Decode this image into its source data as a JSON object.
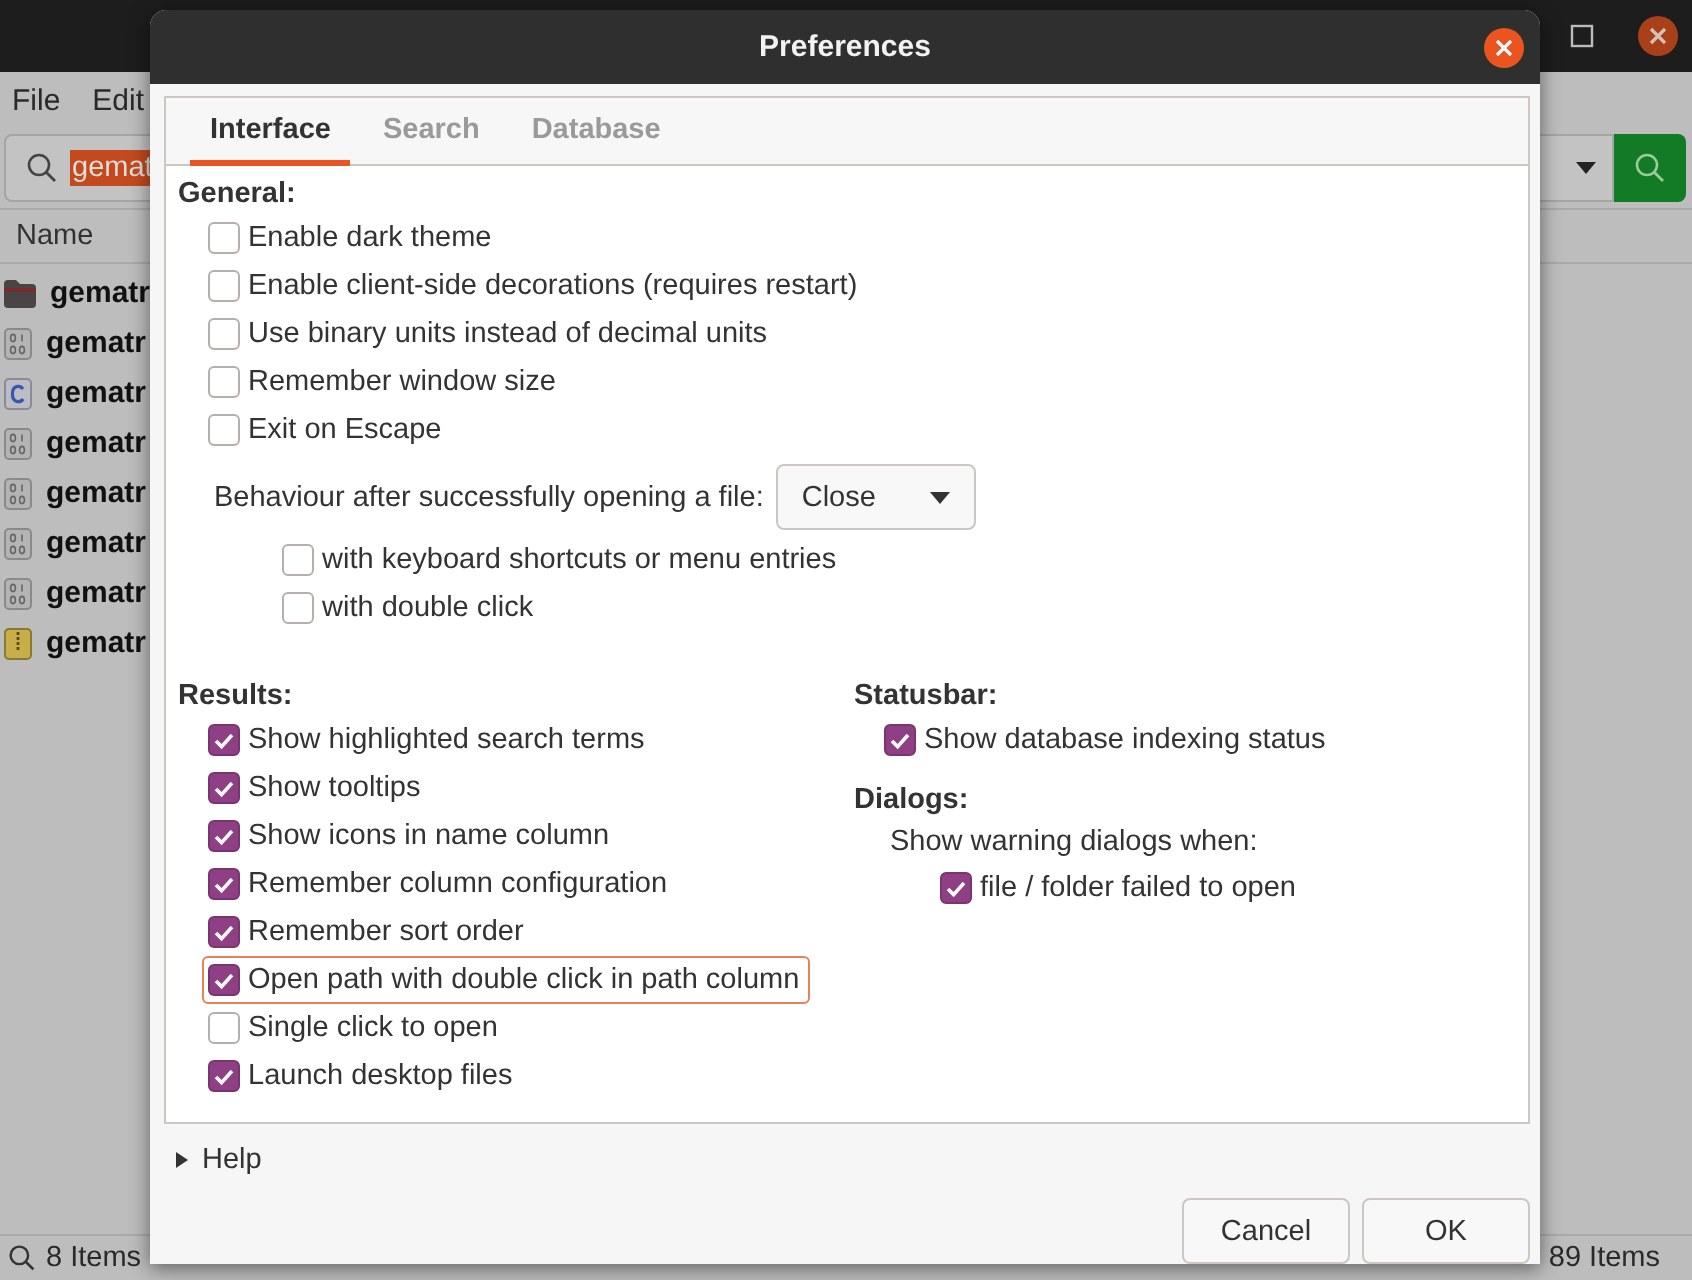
{
  "app": {
    "menu": [
      "File",
      "Edit"
    ],
    "search": {
      "value": "gemat"
    },
    "column_header": "Name",
    "rows": [
      {
        "kind": "folder",
        "name": "gematr"
      },
      {
        "kind": "binary",
        "name": "gematr"
      },
      {
        "kind": "c-source",
        "name": "gematr"
      },
      {
        "kind": "binary",
        "name": "gematr"
      },
      {
        "kind": "binary",
        "name": "gematr"
      },
      {
        "kind": "binary",
        "name": "gematr"
      },
      {
        "kind": "binary",
        "name": "gematr"
      },
      {
        "kind": "archive",
        "name": "gematr"
      }
    ],
    "status_left": "8 Items",
    "status_right": "89 Items"
  },
  "dialog": {
    "title": "Preferences",
    "tabs": [
      {
        "label": "Interface",
        "selected": true
      },
      {
        "label": "Search",
        "selected": false
      },
      {
        "label": "Database",
        "selected": false
      }
    ],
    "general": {
      "heading": "General:",
      "options": [
        {
          "label": "Enable dark theme",
          "checked": false
        },
        {
          "label": "Enable client-side decorations (requires restart)",
          "checked": false
        },
        {
          "label": "Use binary units instead of decimal units",
          "checked": false
        },
        {
          "label": "Remember window size",
          "checked": false
        },
        {
          "label": "Exit on Escape",
          "checked": false
        }
      ],
      "behaviour": {
        "label": "Behaviour after successfully opening a file:",
        "value": "Close"
      },
      "sub_options": [
        {
          "label": "with keyboard shortcuts or menu entries",
          "checked": false
        },
        {
          "label": "with double click",
          "checked": false
        }
      ]
    },
    "results": {
      "heading": "Results:",
      "options": [
        {
          "label": "Show highlighted search terms",
          "checked": true,
          "focused": false
        },
        {
          "label": "Show tooltips",
          "checked": true,
          "focused": false
        },
        {
          "label": "Show icons in name column",
          "checked": true,
          "focused": false
        },
        {
          "label": "Remember column configuration",
          "checked": true,
          "focused": false
        },
        {
          "label": "Remember sort order",
          "checked": true,
          "focused": false
        },
        {
          "label": "Open path with double click in path column",
          "checked": true,
          "focused": true
        },
        {
          "label": "Single click to open",
          "checked": false,
          "focused": false
        },
        {
          "label": "Launch desktop files",
          "checked": true,
          "focused": false
        }
      ]
    },
    "statusbar": {
      "heading": "Statusbar:",
      "options": [
        {
          "label": "Show database indexing status",
          "checked": true
        }
      ]
    },
    "dialogs": {
      "heading": "Dialogs:",
      "note": "Show warning dialogs when:",
      "options": [
        {
          "label": "file / folder failed to open",
          "checked": true
        }
      ]
    },
    "help": {
      "label": "Help",
      "expanded": false
    },
    "buttons": [
      "Cancel",
      "OK"
    ]
  }
}
